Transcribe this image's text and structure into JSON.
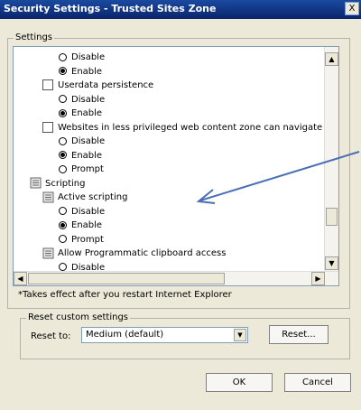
{
  "window": {
    "title": "Security Settings - Trusted Sites Zone",
    "close_label": "X"
  },
  "settings_group": {
    "label": "Settings"
  },
  "list_items": [
    {
      "kind": "radio",
      "label": "Disable",
      "selected": false
    },
    {
      "kind": "radio",
      "label": "Enable",
      "selected": true
    },
    {
      "kind": "checkbox",
      "label": "Userdata persistence"
    },
    {
      "kind": "radio",
      "label": "Disable",
      "selected": false
    },
    {
      "kind": "radio",
      "label": "Enable",
      "selected": true
    },
    {
      "kind": "checkbox",
      "label": "Websites in less privileged web content zone can navigate in"
    },
    {
      "kind": "radio",
      "label": "Disable",
      "selected": false
    },
    {
      "kind": "radio",
      "label": "Enable",
      "selected": true
    },
    {
      "kind": "radio",
      "label": "Prompt",
      "selected": false
    },
    {
      "kind": "category",
      "label": "Scripting"
    },
    {
      "kind": "category",
      "label": "Active scripting"
    },
    {
      "kind": "radio",
      "label": "Disable",
      "selected": false
    },
    {
      "kind": "radio",
      "label": "Enable",
      "selected": true
    },
    {
      "kind": "radio",
      "label": "Prompt",
      "selected": false
    },
    {
      "kind": "category",
      "label": "Allow Programmatic clipboard access"
    },
    {
      "kind": "radio",
      "label": "Disable",
      "selected": false
    }
  ],
  "note": "*Takes effect after you restart Internet Explorer",
  "reset_group": {
    "label": "Reset custom settings",
    "reset_to_label": "Reset to:",
    "selected_level": "Medium (default)",
    "reset_button": "Reset..."
  },
  "buttons": {
    "ok": "OK",
    "cancel": "Cancel"
  },
  "colors": {
    "title_bar": "#0a246a",
    "annotation_arrow": "#4a6fb5"
  }
}
